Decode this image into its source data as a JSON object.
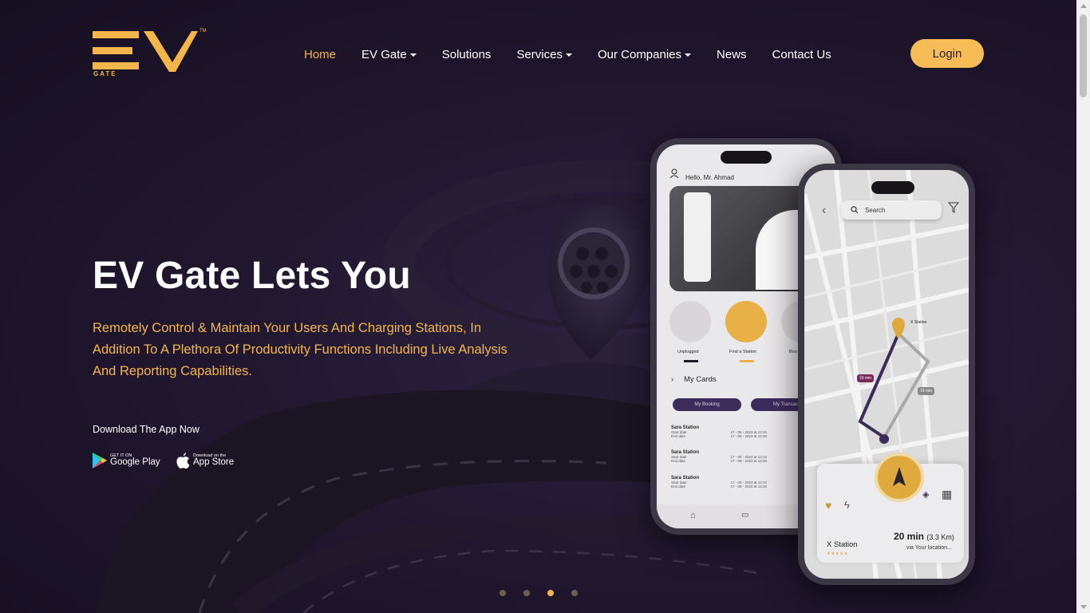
{
  "header": {
    "logo_text": "EV",
    "logo_sub": "GATE",
    "logo_tm": "TM",
    "nav": [
      {
        "label": "Home",
        "active": true,
        "dropdown": false
      },
      {
        "label": "EV Gate",
        "active": false,
        "dropdown": true
      },
      {
        "label": "Solutions",
        "active": false,
        "dropdown": false
      },
      {
        "label": "Services",
        "active": false,
        "dropdown": true
      },
      {
        "label": "Our Companies",
        "active": false,
        "dropdown": true
      },
      {
        "label": "News",
        "active": false,
        "dropdown": false
      },
      {
        "label": "Contact Us",
        "active": false,
        "dropdown": false
      }
    ],
    "login_label": "Login"
  },
  "hero": {
    "title": "EV Gate Lets You",
    "description": "Remotely Control & Maintain Your Users And Charging Stations, In Addition To A Plethora Of Productivity Functions Including Live Analysis And Reporting Capabilities.",
    "download_label": "Download The App Now",
    "google_play": {
      "small": "GET IT ON",
      "big": "Google Play"
    },
    "app_store": {
      "small": "Download on the",
      "big": "App Store"
    }
  },
  "carousel": {
    "count": 4,
    "active_index": 2
  },
  "phone_left": {
    "greeting": "Hello, Mr. Ahmad",
    "actions": [
      "Unplugged",
      "Find a Station",
      "Boo"
    ],
    "my_cards": "My Cards",
    "tabs": [
      "My Booking",
      "My Transacti"
    ],
    "bookings": [
      {
        "station": "Sara Station",
        "start_label": "Start date",
        "start": "17 - 09 - 2023 at 12:15",
        "end_label": "End date",
        "end": "17 - 09 - 2023 at 12:30"
      },
      {
        "station": "Sara Station",
        "start_label": "Start date",
        "start": "17 - 09 - 2023 at 12:15",
        "end_label": "End date",
        "end": "17 - 09 - 2023 at 12:30"
      },
      {
        "station": "Sara Station",
        "start_label": "Start date",
        "start": "17 - 09 - 2023 at 12:15",
        "end_label": "End date",
        "end": "17 - 09 - 2023 at 12:30"
      }
    ]
  },
  "phone_right": {
    "search_placeholder": "Search",
    "map_pin_label": "X Station",
    "route_tag_1": "19 min",
    "route_tag_2": "19 min",
    "station_name": "X Station",
    "eta": "20 min",
    "distance": "(3.3 Km)",
    "via": "via Your location..."
  },
  "colors": {
    "accent": "#f3b64a",
    "background": "#1a1228",
    "login_bg": "#f6bd56"
  }
}
